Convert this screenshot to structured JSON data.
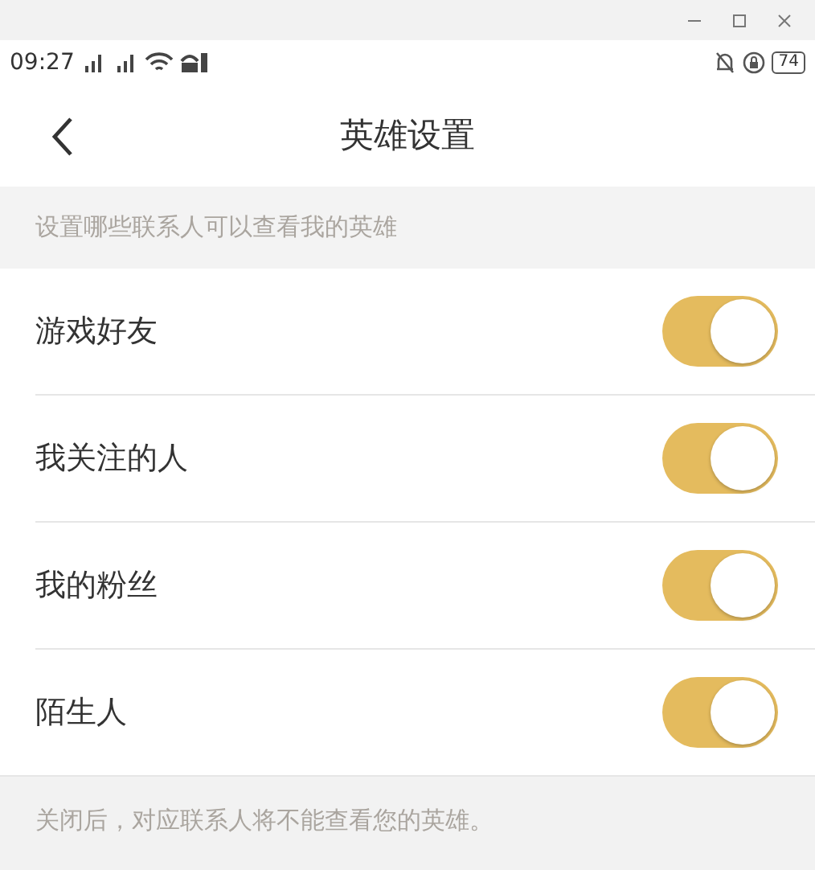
{
  "status_bar": {
    "time": "09:27",
    "battery": "74"
  },
  "nav": {
    "title": "英雄设置"
  },
  "section_header": "设置哪些联系人可以查看我的英雄",
  "settings": [
    {
      "label": "游戏好友",
      "on": true
    },
    {
      "label": "我关注的人",
      "on": true
    },
    {
      "label": "我的粉丝",
      "on": true
    },
    {
      "label": "陌生人",
      "on": true
    }
  ],
  "footer_note": "关闭后，对应联系人将不能查看您的英雄。"
}
